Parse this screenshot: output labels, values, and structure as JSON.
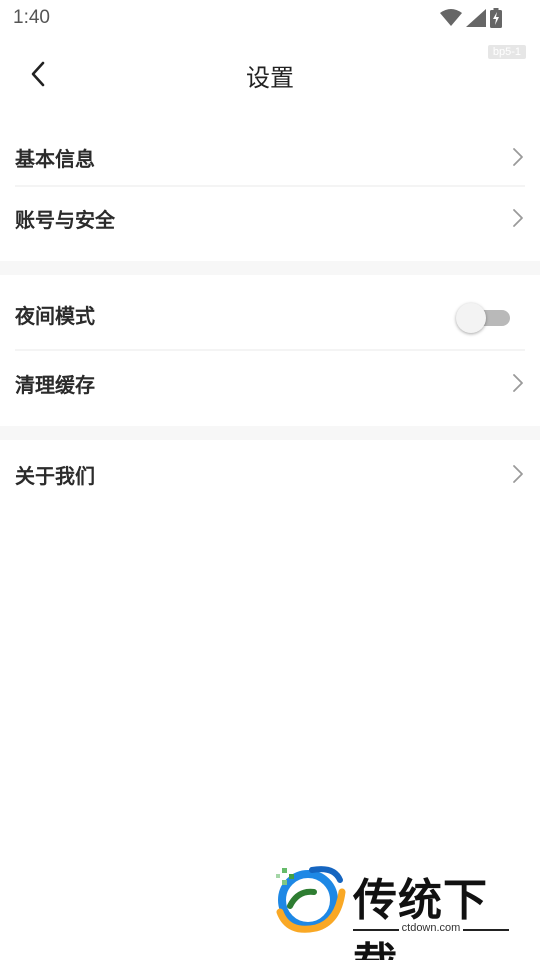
{
  "status_bar": {
    "time": "1:40",
    "icons": [
      "wifi-icon",
      "signal-icon",
      "battery-charging-icon"
    ]
  },
  "header": {
    "back_icon": "back-arrow-icon",
    "title": "设置",
    "tag": "bp5-1"
  },
  "sections": [
    {
      "items": [
        {
          "label": "基本信息",
          "type": "link",
          "icon": "chevron-right-icon"
        },
        {
          "label": "账号与安全",
          "type": "link",
          "icon": "chevron-right-icon"
        }
      ]
    },
    {
      "items": [
        {
          "label": "夜间模式",
          "type": "toggle",
          "on": false
        },
        {
          "label": "清理缓存",
          "type": "link",
          "icon": "chevron-right-icon"
        }
      ]
    },
    {
      "items": [
        {
          "label": "关于我们",
          "type": "link",
          "icon": "chevron-right-icon"
        }
      ]
    }
  ],
  "watermark": {
    "brand": "传统下载",
    "url": "ctdown.com",
    "logo_icon": "ctdown-logo-icon"
  },
  "colors": {
    "text_primary": "#2b2b2b",
    "chevron": "#9a9a9a",
    "section_gap": "#f7f7f7",
    "toggle_track_off": "#b9b9b9",
    "toggle_knob": "#f3f3f3"
  }
}
